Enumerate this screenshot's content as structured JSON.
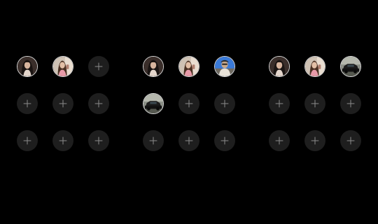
{
  "panels": [
    {
      "slots": [
        {
          "state": "photo",
          "icon": "portrait-dark-hair-icon"
        },
        {
          "state": "photo",
          "icon": "portrait-pink-top-icon"
        },
        {
          "state": "empty",
          "icon": "plus-icon"
        },
        {
          "state": "empty",
          "icon": "plus-icon"
        },
        {
          "state": "empty",
          "icon": "plus-icon"
        },
        {
          "state": "empty",
          "icon": "plus-icon"
        },
        {
          "state": "empty",
          "icon": "plus-icon"
        },
        {
          "state": "empty",
          "icon": "plus-icon"
        },
        {
          "state": "empty",
          "icon": "plus-icon"
        }
      ]
    },
    {
      "slots": [
        {
          "state": "photo",
          "icon": "portrait-dark-hair-icon"
        },
        {
          "state": "photo",
          "icon": "portrait-pink-top-icon"
        },
        {
          "state": "photo",
          "icon": "portrait-blue-sky-icon"
        },
        {
          "state": "photo",
          "icon": "car-icon"
        },
        {
          "state": "empty",
          "icon": "plus-icon"
        },
        {
          "state": "empty",
          "icon": "plus-icon"
        },
        {
          "state": "empty",
          "icon": "plus-icon"
        },
        {
          "state": "empty",
          "icon": "plus-icon"
        },
        {
          "state": "empty",
          "icon": "plus-icon"
        }
      ]
    },
    {
      "slots": [
        {
          "state": "photo",
          "icon": "portrait-dark-hair-icon"
        },
        {
          "state": "photo",
          "icon": "portrait-pink-top-icon"
        },
        {
          "state": "photo",
          "icon": "car-icon"
        },
        {
          "state": "empty",
          "icon": "plus-icon"
        },
        {
          "state": "empty",
          "icon": "plus-icon"
        },
        {
          "state": "empty",
          "icon": "plus-icon"
        },
        {
          "state": "empty",
          "icon": "plus-icon"
        },
        {
          "state": "empty",
          "icon": "plus-icon"
        },
        {
          "state": "empty",
          "icon": "plus-icon"
        }
      ]
    }
  ],
  "colors": {
    "background": "#000000",
    "empty_slot": "#1e1e1e",
    "plus": "#8c8c8c",
    "photo_border": "#d9d9d9"
  }
}
